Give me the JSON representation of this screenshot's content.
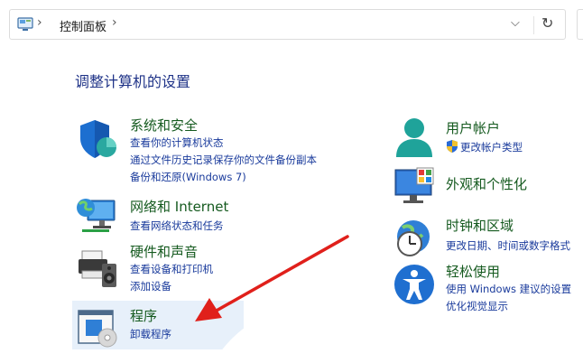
{
  "address_bar": {
    "path": "控制面板",
    "dropdown_glyph": "⌵",
    "refresh_glyph": "↻",
    "separator_glyph": "›"
  },
  "heading": "调整计算机的设置",
  "categories_left": [
    {
      "title": "系统和安全",
      "icon": "shield-icon",
      "links": [
        "查看你的计算机状态",
        "通过文件历史记录保存你的文件备份副本",
        "备份和还原(Windows 7)"
      ]
    },
    {
      "title": "网络和 Internet",
      "icon": "network-globe-icon",
      "links": [
        "查看网络状态和任务"
      ]
    },
    {
      "title": "硬件和声音",
      "icon": "printer-speaker-icon",
      "links": [
        "查看设备和打印机",
        "添加设备"
      ]
    },
    {
      "title": "程序",
      "icon": "programs-disc-icon",
      "links": [
        "卸载程序"
      ]
    }
  ],
  "categories_right": [
    {
      "title": "用户帐户",
      "icon": "user-account-icon",
      "links": [
        "更改帐户类型"
      ]
    },
    {
      "title": "外观和个性化",
      "icon": "monitor-palette-icon",
      "links": []
    },
    {
      "title": "时钟和区域",
      "icon": "clock-globe-icon",
      "links": [
        "更改日期、时间或数字格式"
      ]
    },
    {
      "title": "轻松使用",
      "icon": "accessibility-icon",
      "links": [
        "使用 Windows 建议的设置",
        "优化视觉显示"
      ]
    }
  ],
  "colors": {
    "title_green": "#155a1f",
    "link_blue": "#1a3b9c",
    "heading_blue": "#1e3287",
    "arrow_red": "#e0201b",
    "highlight": "#e7f0fa"
  }
}
